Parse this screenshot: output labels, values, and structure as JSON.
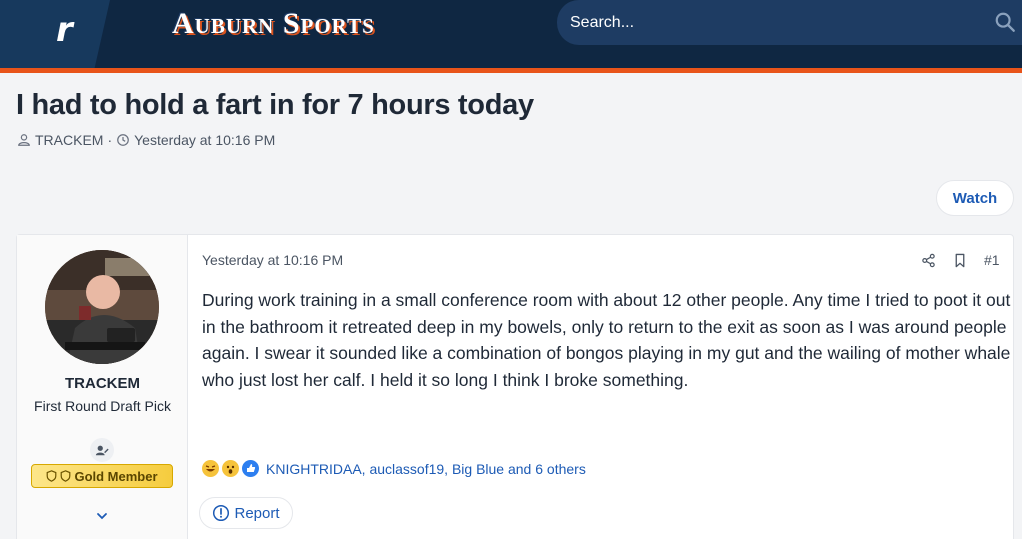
{
  "header": {
    "logo_letter": "r",
    "site_name": "Auburn Sports",
    "search_placeholder": "Search..."
  },
  "thread": {
    "title": "I had to hold a fart in for 7 hours today",
    "author": "TRACKEM",
    "separator": "·",
    "timestamp": "Yesterday at 10:16 PM",
    "watch_label": "Watch"
  },
  "post": {
    "user": {
      "name": "TRACKEM",
      "title": "First Round Draft Pick",
      "badge": "Gold Member"
    },
    "date": "Yesterday at 10:16 PM",
    "number": "#1",
    "body": "During work training in a small conference room with about 12 other people. Any time I tried to poot it out in the bathroom it retreated deep in my bowels, only to return to the exit as soon as I was around people again. I swear it sounded like a combination of bongos playing in my gut and the wailing of mother whale who just lost her calf. I held it so long I think I broke something.",
    "reactions": {
      "icons": [
        "laugh-emoji",
        "wow-emoji",
        "like-emoji"
      ],
      "names": "KNIGHTRIDAA, auclassof19, Big Blue and 6 others"
    },
    "report_label": "Report"
  },
  "colors": {
    "header_bg": "#0f2742",
    "accent": "#e8541a",
    "link": "#1d5bb5",
    "gold": "#f5cc3e"
  }
}
